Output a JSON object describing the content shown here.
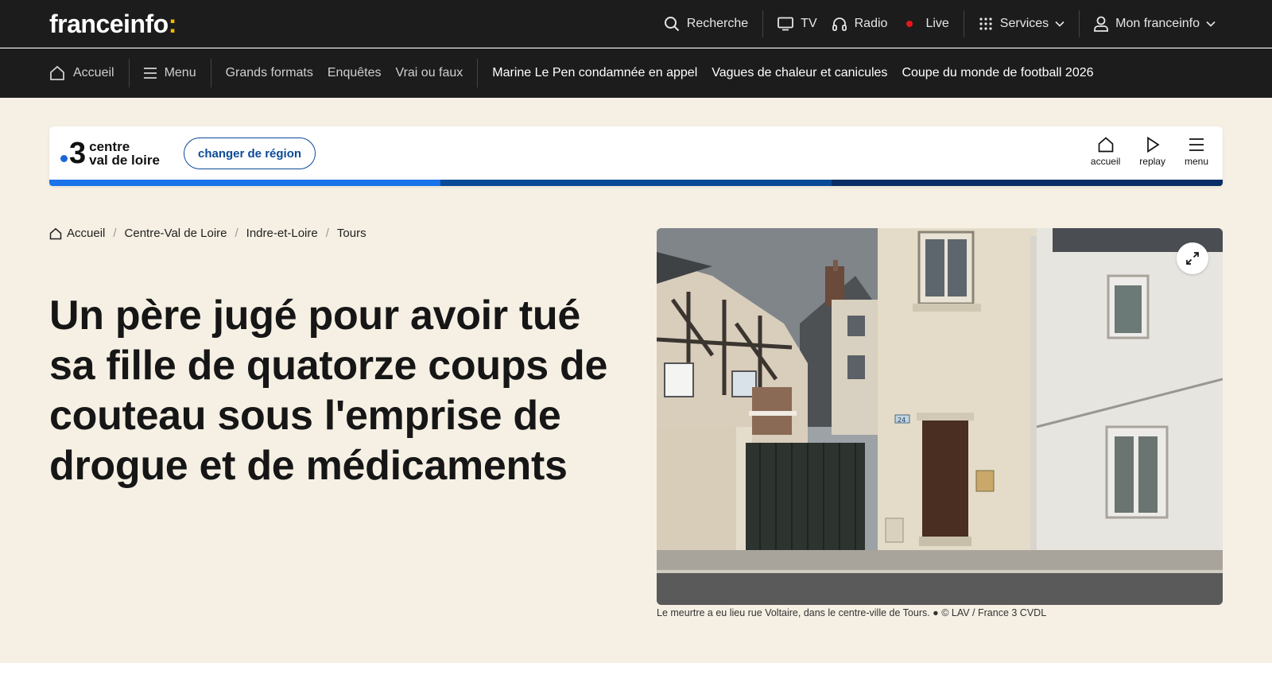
{
  "brand": {
    "name": "franceinfo",
    "colon": ":"
  },
  "topnav": {
    "search": "Recherche",
    "tv": "TV",
    "radio": "Radio",
    "live": "Live",
    "services": "Services",
    "account": "Mon franceinfo"
  },
  "subnav": {
    "home": "Accueil",
    "menu": "Menu",
    "links": [
      "Grands formats",
      "Enquêtes",
      "Vrai ou faux"
    ],
    "trending": [
      "Marine Le Pen condamnée en appel",
      "Vagues de chaleur et canicules",
      "Coupe du monde de football 2026"
    ]
  },
  "region": {
    "channel_number": "3",
    "name_line1": "centre",
    "name_line2": "val de loire",
    "change_label": "changer de région",
    "actions": {
      "home": "accueil",
      "replay": "replay",
      "menu": "menu"
    },
    "stripe_colors": [
      "#1a73e8",
      "#0b4a98",
      "#0a2f66"
    ]
  },
  "breadcrumb": [
    "Accueil",
    "Centre-Val de Loire",
    "Indre-et-Loire",
    "Tours"
  ],
  "article": {
    "headline": "Un père jugé pour avoir tué sa fille de quatorze coups de couteau sous l'emprise de drogue et de médicaments",
    "caption": "Le meurtre a eu lieu rue Voltaire, dans le centre-ville de Tours. ● © LAV / France 3 CVDL",
    "house_number": "24"
  },
  "colors": {
    "topbar": "#1c1c1c",
    "page_bg": "#f6f0e4",
    "accent_live": "#e5161d",
    "brand_colon": "#f5b700"
  }
}
